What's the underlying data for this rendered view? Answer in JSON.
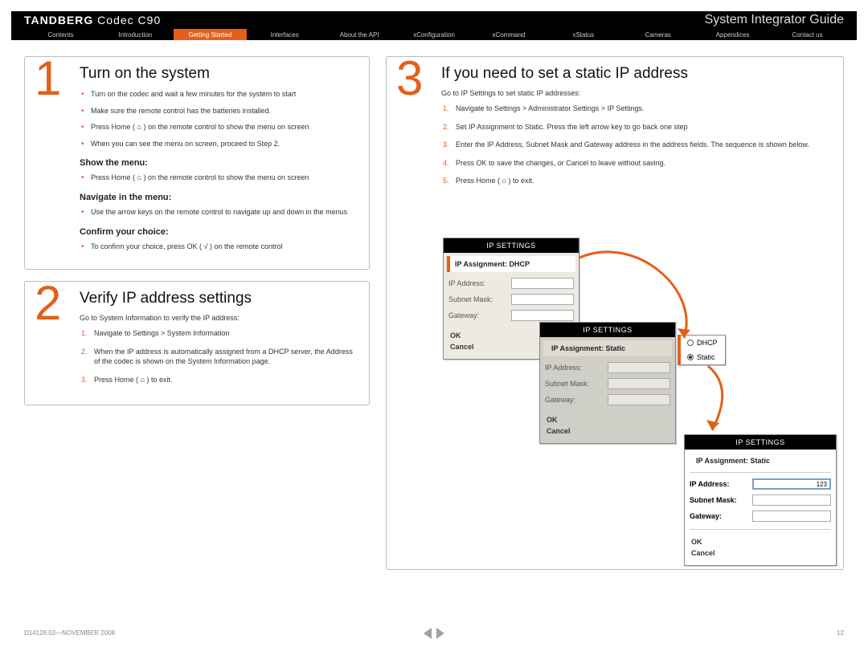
{
  "header": {
    "brand_bold": "TANDBERG",
    "brand_thin": " Codec C90",
    "guide": "System Integrator Guide"
  },
  "tabs": [
    {
      "label": "Contents"
    },
    {
      "label": "Introduction"
    },
    {
      "label": "Getting Started"
    },
    {
      "label": "Interfaces"
    },
    {
      "label": "About the API"
    },
    {
      "label": "xConfiguration"
    },
    {
      "label": "xCommand"
    },
    {
      "label": "xStatus"
    },
    {
      "label": "Cameras"
    },
    {
      "label": "Appendices"
    },
    {
      "label": "Contact us"
    }
  ],
  "step1": {
    "num": "1",
    "title": "Turn on the system",
    "bullets": [
      "Turn on the codec and wait a few minutes for the system to start",
      "Make sure the remote control has the batteries installed.",
      "Press Home ( ⌂ ) on the remote control to show the menu on screen",
      "When you can see the menu on screen, proceed to Step 2."
    ],
    "sub1": "Show the menu:",
    "sub1_bul": [
      "Press Home ( ⌂ ) on the remote control to show the menu on screen"
    ],
    "sub2": "Navigate in the menu:",
    "sub2_bul": [
      "Use the arrow keys on the remote control to navigate up and down in the menus"
    ],
    "sub3": "Confirm your choice:",
    "sub3_bul": [
      "To confirm your choice, press OK ( √ ) on the remote control"
    ]
  },
  "step2": {
    "num": "2",
    "title": "Verify IP address settings",
    "intro": "Go to System Information to verify the IP address:",
    "items": [
      "Navigate to Settings > System Information",
      "When the IP address is automatically assigned from a DHCP server, the Address of the codec is shown on the System Information page.",
      "Press Home ( ⌂ ) to exit."
    ]
  },
  "step3": {
    "num": "3",
    "title": "If you need to set a static IP address",
    "intro": "Go to IP Settings to set static IP addresses:",
    "items": [
      "Navigate to Settings > Administrator Settings > IP Settings.",
      "Set IP Assignment to Static. Press the left arrow key to go back one step",
      "Enter the IP Address, Subnet Mask and Gateway address in the address fields. The sequence is shown below.",
      "Press OK to save the changes, or Cancel to leave without saving.",
      "Press Home ( ⌂ ) to exit."
    ]
  },
  "ipwin": {
    "title": "IP SETTINGS",
    "assign_dhcp": "IP Assignment: DHCP",
    "assign_static": "IP Assignment: Static",
    "ip_address": "IP Address:",
    "subnet": "Subnet Mask:",
    "gateway": "Gateway:",
    "ok": "OK",
    "cancel": "Cancel",
    "dhcp": "DHCP",
    "static": "Static",
    "ipval": "123"
  },
  "footer": {
    "doc": "D14128.02—NOVEMBER 2008",
    "page": "12"
  }
}
